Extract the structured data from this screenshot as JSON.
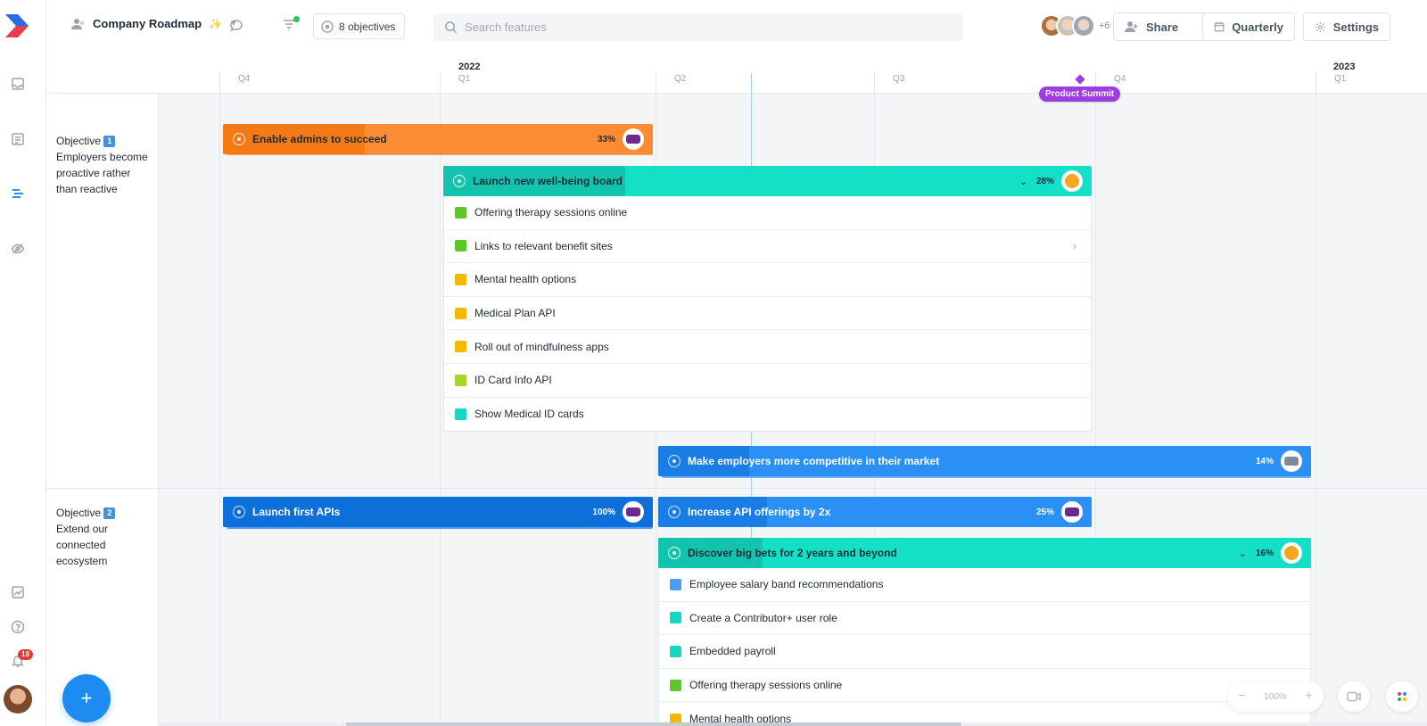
{
  "header": {
    "board_name": "Company Roadmap",
    "board_emoji": "✨",
    "objectives_count": "8 objectives",
    "search_placeholder": "Search features",
    "extra_collaborators": "+6",
    "share_label": "Share",
    "view_label": "Quarterly",
    "settings_label": "Settings"
  },
  "timeline": {
    "quarters": [
      "Q4",
      "Q1",
      "Q2",
      "Q3",
      "Q4",
      "Q1"
    ],
    "years": [
      "2022",
      "2023"
    ],
    "milestone": "Product Summit"
  },
  "lanes": [
    {
      "label": "Objective",
      "number": "1",
      "text": "Employers become proactive rather than reactive"
    },
    {
      "label": "Objective",
      "number": "2",
      "text": "Extend our connected ecosystem"
    }
  ],
  "bars": {
    "enable_admins": {
      "title": "Enable admins to succeed",
      "pct": "33%",
      "progress": 0.33
    },
    "wellbeing": {
      "title": "Launch new well-being board",
      "pct": "28%",
      "progress": 0.28
    },
    "competitive": {
      "title": "Make employers more competitive in their market",
      "pct": "14%",
      "progress": 0.14
    },
    "first_apis": {
      "title": "Launch first APIs",
      "pct": "100%",
      "progress": 1.0
    },
    "api_offerings": {
      "title": "Increase API offerings by 2x",
      "pct": "25%",
      "progress": 0.25
    },
    "big_bets": {
      "title": "Discover big bets for 2 years and beyond",
      "pct": "16%",
      "progress": 0.16
    }
  },
  "wellbeing_features": [
    {
      "name": "Offering therapy sessions online",
      "color": "#5ec52b"
    },
    {
      "name": "Links to relevant benefit sites",
      "color": "#5ec52b"
    },
    {
      "name": "Mental health options",
      "color": "#f5b800"
    },
    {
      "name": "Medical Plan API",
      "color": "#f5b800"
    },
    {
      "name": "Roll out of mindfulness apps",
      "color": "#f5b800"
    },
    {
      "name": "ID Card Info API",
      "color": "#a6d62b"
    },
    {
      "name": "Show Medical ID cards",
      "color": "#14d7c3"
    }
  ],
  "bigbets_features": [
    {
      "name": "Employee salary band recommendations",
      "color": "#4c9cf0"
    },
    {
      "name": "Create a Contributor+ user role",
      "color": "#14d7c3"
    },
    {
      "name": "Embedded payroll",
      "color": "#14d7c3"
    },
    {
      "name": "Offering therapy sessions online",
      "color": "#5ec52b"
    },
    {
      "name": "Mental health options",
      "color": "#f5b800"
    }
  ],
  "notifications_count": "18",
  "zoom": "100%",
  "colors": {
    "accent": "#1d8cf0",
    "orange": "#fb8c33",
    "teal": "#14e0c8",
    "blue": "#2b90f5",
    "milestone": "#9b3de3"
  }
}
